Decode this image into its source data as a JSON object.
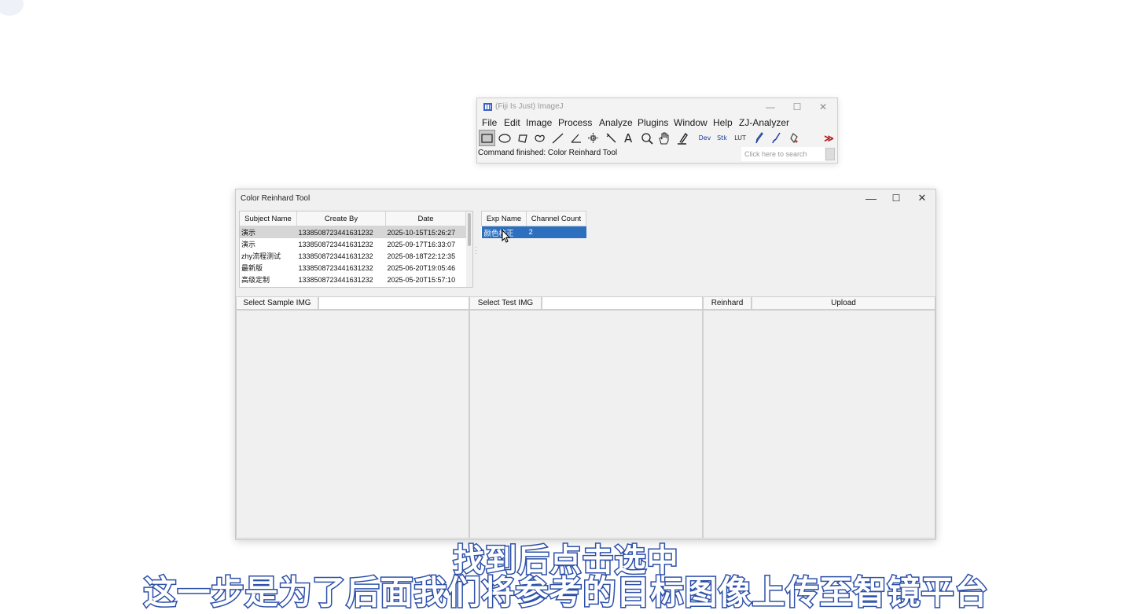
{
  "imagej": {
    "title": "(Fiji Is Just) ImageJ",
    "window_controls": [
      "—",
      "☐",
      "✕"
    ],
    "menu": [
      "File",
      "Edit",
      "Image",
      "Process",
      "Analyze",
      "Plugins",
      "Window",
      "Help",
      "ZJ-Analyzer"
    ],
    "tools": {
      "dev": "Dev",
      "stk": "Stk",
      "lut": "LUT",
      "more": "≫"
    },
    "status": "Command finished: Color Reinhard Tool",
    "search_placeholder": "Click here to search"
  },
  "reinhard": {
    "title": "Color Reinhard Tool",
    "window_controls": [
      "—",
      "☐",
      "✕"
    ],
    "subjects": {
      "headers": [
        "Subject Name",
        "Create By",
        "Date"
      ],
      "rows": [
        [
          "演示",
          "1338508723441631232",
          "2025-10-15T15:26:27"
        ],
        [
          "演示",
          "1338508723441631232",
          "2025-09-17T16:33:07"
        ],
        [
          "zhy流程测试",
          "1338508723441631232",
          "2025-08-18T22:12:35"
        ],
        [
          "最新版",
          "1338508723441631232",
          "2025-06-20T19:05:46"
        ],
        [
          "高级定制",
          "1338508723441631232",
          "2025-05-20T15:57:10"
        ]
      ]
    },
    "experiments": {
      "headers": [
        "Exp Name",
        "Channel Count"
      ],
      "rows": [
        [
          "颜色校正",
          "2"
        ]
      ]
    },
    "buttons": {
      "select_sample": "Select Sample IMG",
      "sample_path": "",
      "select_test": "Select Test IMG",
      "test_path": "",
      "reinhard": "Reinhard",
      "upload": "Upload"
    }
  },
  "subtitles": {
    "line1": "找到后点击选中",
    "line2": "这一步是为了后面我们将参考的目标图像上传至智镜平台"
  }
}
